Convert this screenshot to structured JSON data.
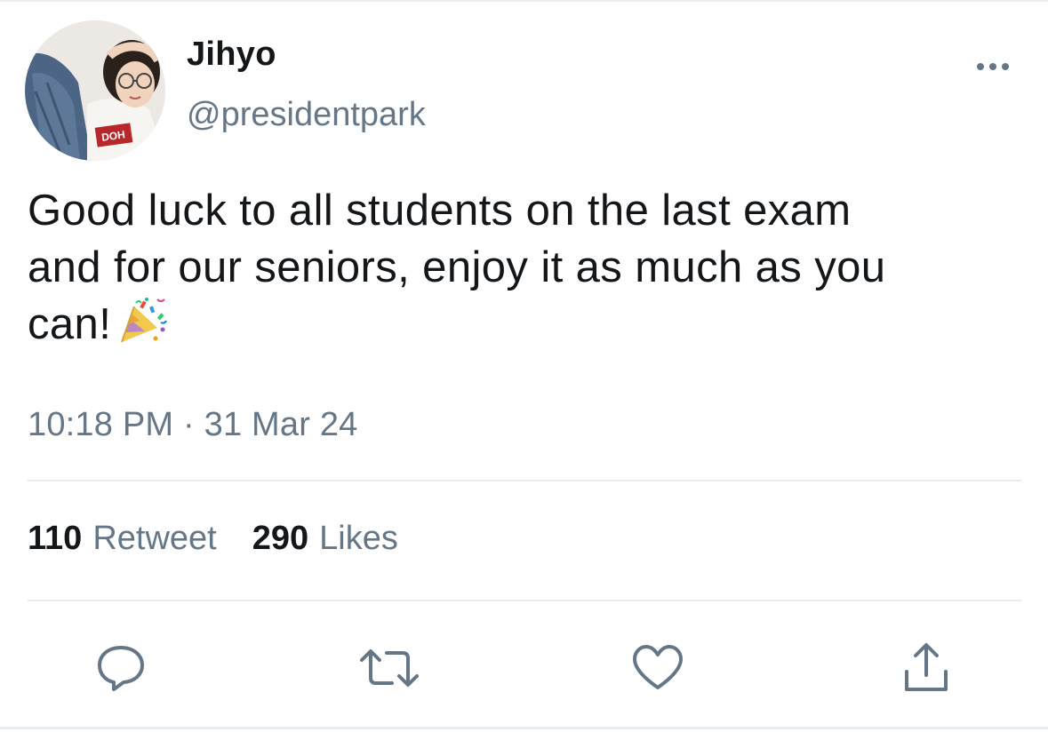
{
  "tweet": {
    "author": {
      "display_name": "Jihyo",
      "handle": "@presidentpark",
      "avatar_icon": "profile-photo"
    },
    "text_line_1": "Good luck to all students on the last exam",
    "text_line_2": "and for our seniors, enjoy it as much as you",
    "text_line_3": "can!",
    "emoji": "party-popper-icon",
    "timestamp": "10:18 PM · 31 Mar 24",
    "stats": {
      "retweet_count": "110",
      "retweet_label": "Retweet",
      "like_count": "290",
      "like_label": "Likes"
    },
    "actions": [
      {
        "name": "reply",
        "icon": "reply-bubble-icon"
      },
      {
        "name": "retweet",
        "icon": "retweet-arrows-icon"
      },
      {
        "name": "like",
        "icon": "heart-icon"
      },
      {
        "name": "share",
        "icon": "share-upload-icon"
      }
    ]
  },
  "colors": {
    "text_primary": "#14171a",
    "text_secondary": "#657786",
    "divider": "#e6ecf0",
    "icon": "#657786"
  }
}
